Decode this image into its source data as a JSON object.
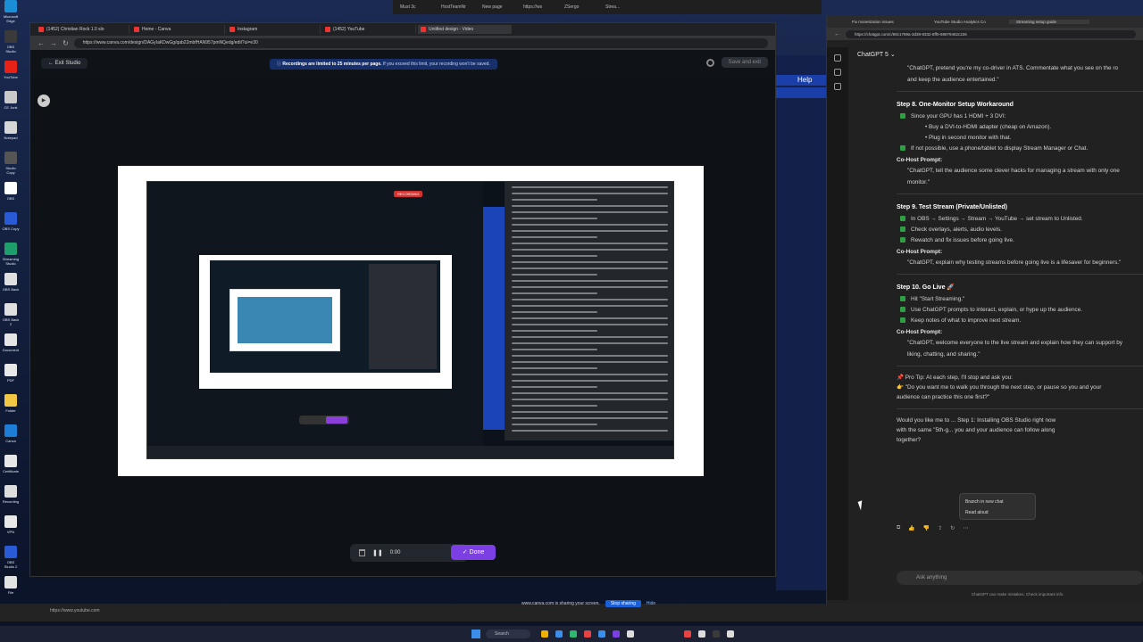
{
  "desktop": {
    "icons": [
      {
        "label": "Microsoft Edge",
        "color": "#1a8fd8"
      },
      {
        "label": "OBS Studio",
        "color": "#3a3a3a"
      },
      {
        "label": "YouTube",
        "color": "#e62117"
      },
      {
        "label": "CE Junk",
        "color": "#c9c9c9"
      },
      {
        "label": "Notepad",
        "color": "#d6d6d6"
      },
      {
        "label": "Studio Copy",
        "color": "#555555"
      },
      {
        "label": "OBS",
        "color": "#ffffff"
      },
      {
        "label": "OBS Copy",
        "color": "#2a5bd7"
      },
      {
        "label": "Streaming Studio",
        "color": "#1e9e6a"
      },
      {
        "label": "OBS Back",
        "color": "#dfdfdf"
      },
      {
        "label": "OBS Back 2",
        "color": "#dfdfdf"
      },
      {
        "label": "Document",
        "color": "#e5e5e5"
      },
      {
        "label": "PDF",
        "color": "#e8e8e8"
      },
      {
        "label": "Folder",
        "color": "#f2c744"
      },
      {
        "label": "Canva",
        "color": "#1c7ed6"
      },
      {
        "label": "Certificate",
        "color": "#e6e6e6"
      },
      {
        "label": "Recording",
        "color": "#dddddd"
      },
      {
        "label": "VPN",
        "color": "#e8e8e8"
      },
      {
        "label": "OBS Studio 2",
        "color": "#2a5bd7"
      },
      {
        "label": "File",
        "color": "#e3e3e3"
      }
    ]
  },
  "bg_browser_tabs": [
    "Must 3c",
    "HostTeamNr",
    "New page",
    "https://ws",
    "ZSergo",
    "Strea..."
  ],
  "canva": {
    "tabs": [
      {
        "label": "(1452) Christian Rock 1.0 slo",
        "active": false
      },
      {
        "label": "Home - Canva",
        "active": false
      },
      {
        "label": "Instagram",
        "active": false
      },
      {
        "label": "(1452) YouTube",
        "active": false
      },
      {
        "label": "Untitled design - Video",
        "active": true
      }
    ],
    "url": "https://www.canva.com/design/DAGyIaKDwGg/qab22mbfHAN957pmNQedg/edit?ui=e30",
    "exit_studio": "Exit Studio",
    "notice_bold": "Recordings are limited to 25 minutes per page.",
    "notice_rest": "If you exceed this limit, your recording won't be saved.",
    "save_exit": "Save and exit",
    "recording_badge": "RECORDING",
    "timer": "0:00",
    "done": "Done"
  },
  "middle": {
    "help": "Help"
  },
  "chatgpt": {
    "tabs": [
      {
        "label": "Fix monetization issues",
        "active": false
      },
      {
        "label": "YouTube Studio Analytics Co",
        "active": false
      },
      {
        "label": "Streaming setup guide",
        "active": true
      }
    ],
    "url": "https://chatgpt.com/c/68c1789a-3d38-8332-8ff0-68979462c226",
    "model": "ChatGPT 5",
    "intro_quote_1": "\"ChatGPT, pretend you're my co-driver in ATS. Commentate what you see on the ro",
    "intro_quote_2": "and keep the audience entertained.\"",
    "step8": {
      "title": "Step 8. One-Monitor Setup Workaround",
      "check1": "Since your GPU has 1 HDMI + 3 DVI:",
      "sub1": "Buy a DVI-to-HDMI adapter (cheap on Amazon).",
      "sub2": "Plug in second monitor with that.",
      "check2": "If not possible, use a phone/tablet to display Stream Manager or Chat.",
      "cohost": "Co-Host Prompt:",
      "quote_1": "\"ChatGPT, tell the audience some clever hacks for managing a stream with only one",
      "quote_2": "monitor.\""
    },
    "step9": {
      "title": "Step 9. Test Stream (Private/Unlisted)",
      "check1": "In OBS → Settings → Stream → YouTube → set stream to Unlisted.",
      "check2": "Check overlays, alerts, audio levels.",
      "check3": "Rewatch and fix issues before going live.",
      "cohost": "Co-Host Prompt:",
      "quote": "\"ChatGPT, explain why testing streams before going live is a lifesaver for beginners.\""
    },
    "step10": {
      "title": "Step 10. Go Live 🚀",
      "check1": "Hit \"Start Streaming.\"",
      "check2": "Use ChatGPT prompts to interact, explain, or hype up the audience.",
      "check3": "Keep notes of what to improve next stream.",
      "cohost": "Co-Host Prompt:",
      "quote_1": "\"ChatGPT, welcome everyone to the live stream and explain how they can support by",
      "quote_2": "liking, chatting, and sharing.\""
    },
    "pro_tip_1": "📌 Pro Tip: At each step, I'll stop and ask you:",
    "pro_tip_2": "👉 \"Do you want me to walk you through the next step, or pause so you and your",
    "pro_tip_3": "audience can practice this one first?\"",
    "final_1": "Would you like me to ... Step 1: Installing OBS Studio right now",
    "final_2": "with the same \"5th-g... you and your audience can follow along",
    "final_3": "together?",
    "context_menu": [
      "Branch in new chat",
      "Read aloud"
    ],
    "ask_placeholder": "Ask anything",
    "disclaimer": "ChatGPT can make mistakes. Check important info."
  },
  "bottom": {
    "url": "https://www.youtube.com",
    "share_msg": "www.canva.com is sharing your screen.",
    "stop_sharing": "Stop sharing",
    "hide": "Hide"
  },
  "taskbar": {
    "search": "Search"
  }
}
